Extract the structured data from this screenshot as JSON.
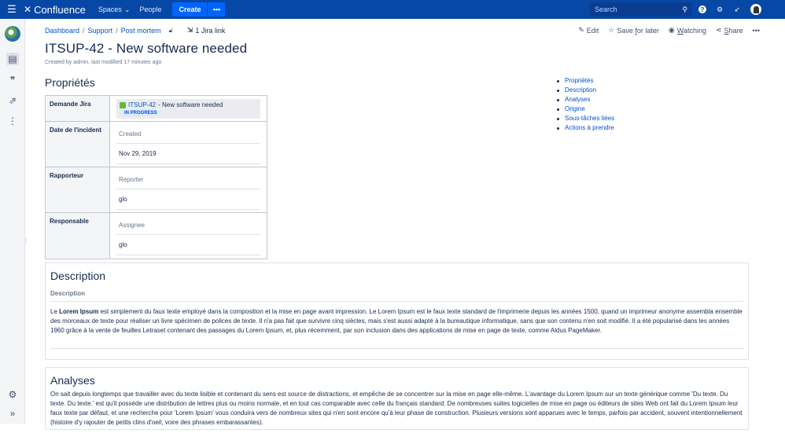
{
  "topnav": {
    "product": "Confluence",
    "spaces": "Spaces",
    "people": "People",
    "create": "Create",
    "create_more": "•••",
    "search_placeholder": "Search"
  },
  "breadcrumb": {
    "items": [
      "Dashboard",
      "Support",
      "Post mortem"
    ],
    "jira_link": "1 Jira link"
  },
  "actions": {
    "edit": "Edit",
    "save_prefix": "Save ",
    "save_underlined": "f",
    "save_suffix": "or later",
    "watching_prefix": "",
    "watching_underlined": "W",
    "watching_suffix": "atching",
    "share_prefix": "",
    "share_underlined": "S",
    "share_suffix": "hare",
    "more": "•••"
  },
  "page": {
    "title": "ITSUP-42 - New software needed",
    "byline": "Created by admin, last modified 17 minutes ago"
  },
  "properties": {
    "heading": "Propriétés",
    "rows": [
      {
        "key": "Demande Jira",
        "issue_key": "ITSUP-42",
        "issue_summary": " - New software needed",
        "status": "IN PROGRESS"
      },
      {
        "key": "Date de l'incident",
        "label": "Created",
        "value": "Nov 29, 2019"
      },
      {
        "key": "Rapporteur",
        "label": "Reporter",
        "value": "glo"
      },
      {
        "key": "Responsable",
        "label": "Assignee",
        "value": "glo"
      }
    ]
  },
  "toc": [
    "Propriétés",
    "Description",
    "Analyses",
    "Origine",
    "Sous-tâches liées",
    "Actions à prendre"
  ],
  "description": {
    "title": "Description",
    "subheading": "Description",
    "text_prefix": "Le ",
    "text_bold": "Lorem Ipsum",
    "text_rest": " est simplement du faux texte employé dans la composition et la mise en page avant impression. Le Lorem Ipsum est le faux texte standard de l'imprimerie depuis les années 1500, quand un imprimeur anonyme assembla ensemble des morceaux de texte pour réaliser un livre spécimen de polices de texte. Il n'a pas fait que survivre cinq siècles, mais s'est aussi adapté à la bureautique informatique, sans que son contenu n'en soit modifié. Il a été popularisé dans les années 1960 grâce à la vente de feuilles Letraset contenant des passages du Lorem Ipsum, et, plus récemment, par son inclusion dans des applications de mise en page de texte, comme Aldus PageMaker."
  },
  "analyses": {
    "title": "Analyses",
    "text": "On sait depuis longtemps que travailler avec du texte lisible et contenant du sens est source de distractions, et empêche de se concentrer sur la mise en page elle-même. L'avantage du Lorem Ipsum sur un texte générique comme 'Du texte. Du texte. Du texte.' est qu'il possède une distribution de lettres plus ou moins normale, et en tout cas comparable avec celle du français standard. De nombreuses suites logicielles de mise en page ou éditeurs de sites Web ont fait du Lorem Ipsum leur faux texte par défaut, et une recherche pour 'Lorem Ipsum' vous conduira vers de nombreux sites qui n'en sont encore qu'à leur phase de construction. Plusieurs versions sont apparues avec le temps, parfois par accident, souvent intentionnellement (histoire d'y rajouter de petits clins d'oeil, voire des phrases embarassantes)."
  },
  "colors": {
    "nav_bg": "#0747a6",
    "create_bg": "#0065ff",
    "link": "#0052cc",
    "status_bg": "#deebff"
  }
}
